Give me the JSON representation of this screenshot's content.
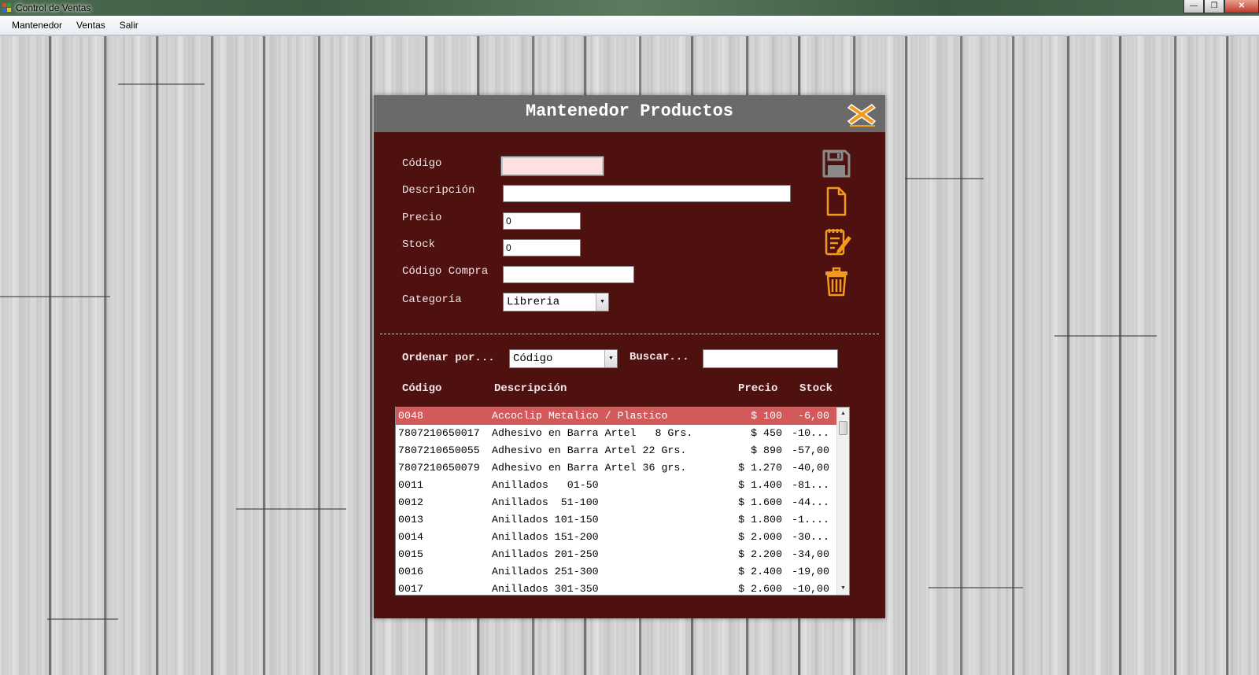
{
  "window": {
    "title": "Control de Ventas"
  },
  "menu": {
    "items": [
      "Mantenedor",
      "Ventas",
      "Salir"
    ]
  },
  "dialog": {
    "title": "Mantenedor Productos",
    "form": {
      "codigo_label": "Código",
      "codigo_value": "",
      "descripcion_label": "Descripción",
      "descripcion_value": "",
      "precio_label": "Precio",
      "precio_value": "0",
      "stock_label": "Stock",
      "stock_value": "0",
      "codigo_compra_label": "Código Compra",
      "codigo_compra_value": "",
      "categoria_label": "Categoría",
      "categoria_value": "Libreria"
    },
    "toolbar": [
      "save-icon",
      "new-document-icon",
      "edit-icon",
      "trash-icon"
    ],
    "search": {
      "ordenar_label": "Ordenar por...",
      "ordenar_value": "Código",
      "buscar_label": "Buscar...",
      "buscar_value": ""
    },
    "grid": {
      "headers": {
        "codigo": "Código",
        "descripcion": "Descripción",
        "precio": "Precio",
        "stock": "Stock"
      },
      "rows": [
        {
          "codigo": "0048",
          "descripcion": "Accoclip Metalico / Plastico",
          "precio": "$ 100",
          "stock": "-6,00",
          "selected": true
        },
        {
          "codigo": "7807210650017",
          "descripcion": "Adhesivo en Barra Artel   8 Grs.",
          "precio": "$ 450",
          "stock": "-10..."
        },
        {
          "codigo": "7807210650055",
          "descripcion": "Adhesivo en Barra Artel 22 Grs.",
          "precio": "$ 890",
          "stock": "-57,00"
        },
        {
          "codigo": "7807210650079",
          "descripcion": "Adhesivo en Barra Artel 36 grs.",
          "precio": "$ 1.270",
          "stock": "-40,00"
        },
        {
          "codigo": "0011",
          "descripcion": "Anillados   01-50",
          "precio": "$ 1.400",
          "stock": "-81..."
        },
        {
          "codigo": "0012",
          "descripcion": "Anillados  51-100",
          "precio": "$ 1.600",
          "stock": "-44..."
        },
        {
          "codigo": "0013",
          "descripcion": "Anillados 101-150",
          "precio": "$ 1.800",
          "stock": "-1...."
        },
        {
          "codigo": "0014",
          "descripcion": "Anillados 151-200",
          "precio": "$ 2.000",
          "stock": "-30..."
        },
        {
          "codigo": "0015",
          "descripcion": "Anillados 201-250",
          "precio": "$ 2.200",
          "stock": "-34,00"
        },
        {
          "codigo": "0016",
          "descripcion": "Anillados 251-300",
          "precio": "$ 2.400",
          "stock": "-19,00"
        },
        {
          "codigo": "0017",
          "descripcion": "Anillados 301-350",
          "precio": "$ 2.600",
          "stock": "-10,00"
        }
      ]
    }
  },
  "colors": {
    "dialog_bg": "#4f1010",
    "header_bg": "#6a6a6a",
    "accent_orange": "#f29a1e",
    "selected_row": "#d25a5a",
    "required_field": "#ffe0e0"
  }
}
